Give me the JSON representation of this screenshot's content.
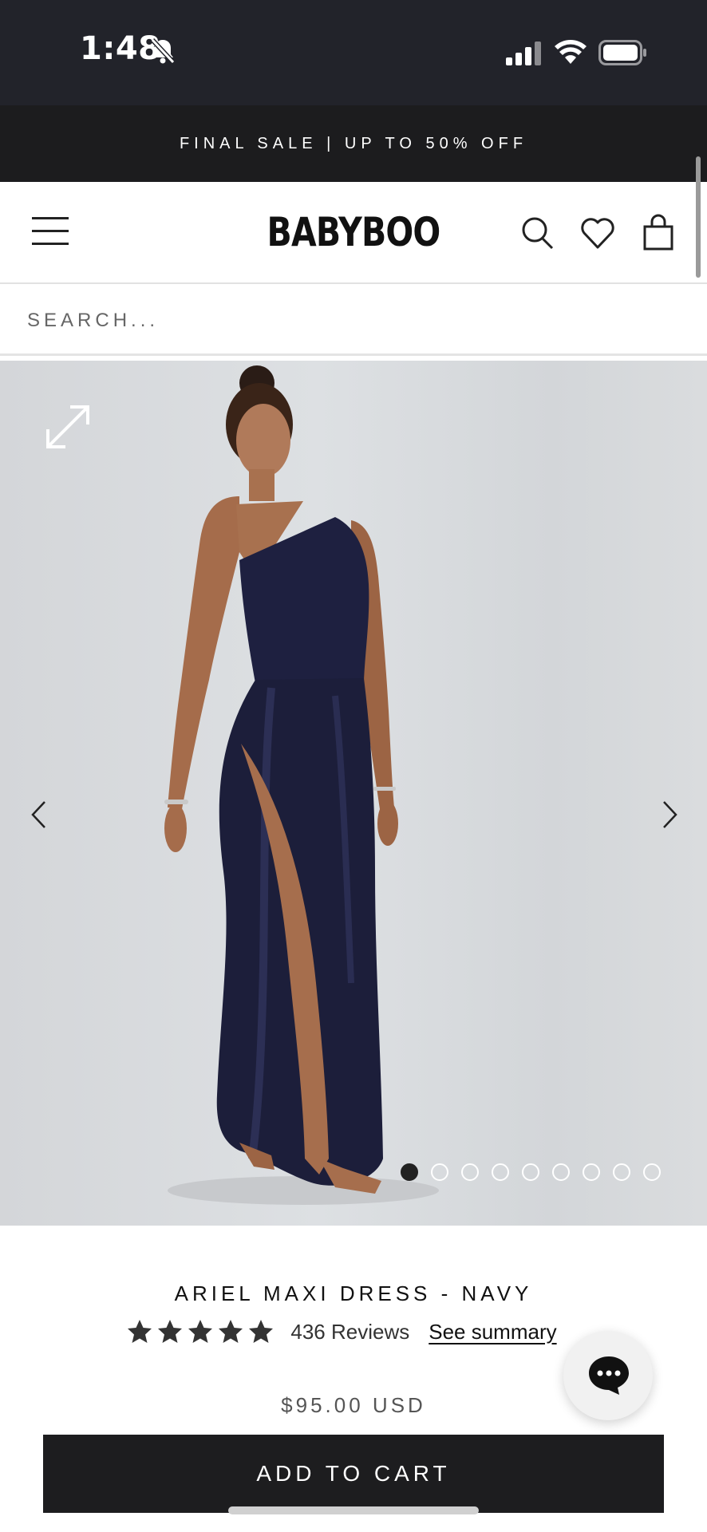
{
  "status_bar": {
    "time": "1:48"
  },
  "promo_banner": {
    "text": "FINAL SALE | UP TO 50% OFF"
  },
  "header": {
    "logo": "BABYBOO"
  },
  "search": {
    "placeholder": "SEARCH..."
  },
  "gallery": {
    "image_count": 9,
    "active_index": 0
  },
  "product": {
    "title": "ARIEL MAXI DRESS - NAVY",
    "rating": 5,
    "reviews_label": "436 Reviews",
    "see_summary_label": "See summary",
    "price": "$95.00 USD",
    "add_to_cart_label": "ADD TO CART"
  },
  "colors": {
    "dark": "#1d1d1f",
    "status_bg": "#22232a",
    "dress": "#1c1e3a"
  }
}
